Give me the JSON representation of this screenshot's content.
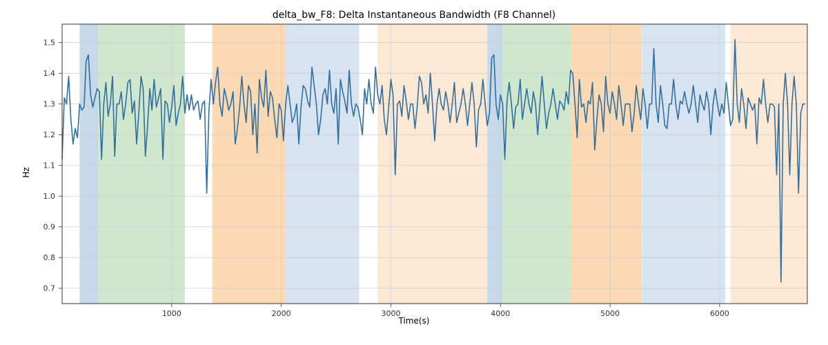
{
  "chart_data": {
    "type": "line",
    "title": "delta_bw_F8: Delta Instantaneous Bandwidth (F8 Channel)",
    "xlabel": "Time(s)",
    "ylabel": "Hz",
    "xlim": [
      0,
      6800
    ],
    "ylim": [
      0.65,
      1.56
    ],
    "xticks": [
      1000,
      2000,
      3000,
      4000,
      5000,
      6000
    ],
    "yticks": [
      0.7,
      0.8,
      0.9,
      1.0,
      1.1,
      1.2,
      1.3,
      1.4,
      1.5
    ],
    "bands": [
      {
        "x0": 160,
        "x1": 330,
        "color": "#c5d9e8"
      },
      {
        "x0": 330,
        "x1": 1120,
        "color": "#cfe7cc"
      },
      {
        "x0": 1370,
        "x1": 2040,
        "color": "#fad9b3"
      },
      {
        "x0": 2040,
        "x1": 2710,
        "color": "#d7e3f0"
      },
      {
        "x0": 2880,
        "x1": 3880,
        "color": "#fce8d3"
      },
      {
        "x0": 3880,
        "x1": 4020,
        "color": "#c5d9e8"
      },
      {
        "x0": 4020,
        "x1": 4640,
        "color": "#cfe7cc"
      },
      {
        "x0": 4640,
        "x1": 5290,
        "color": "#fad9b3"
      },
      {
        "x0": 5290,
        "x1": 6050,
        "color": "#d7e3f0"
      },
      {
        "x0": 6100,
        "x1": 6800,
        "color": "#fce8d3"
      }
    ],
    "series": [
      {
        "name": "delta_bw_F8",
        "color": "#2f6f9f",
        "x_step": 20,
        "values": [
          1.12,
          1.32,
          1.3,
          1.39,
          1.25,
          1.17,
          1.22,
          1.19,
          1.3,
          1.28,
          1.29,
          1.44,
          1.46,
          1.33,
          1.29,
          1.32,
          1.35,
          1.34,
          1.12,
          1.3,
          1.37,
          1.26,
          1.3,
          1.39,
          1.13,
          1.3,
          1.3,
          1.34,
          1.25,
          1.3,
          1.37,
          1.38,
          1.27,
          1.31,
          1.17,
          1.27,
          1.39,
          1.35,
          1.13,
          1.23,
          1.35,
          1.28,
          1.38,
          1.29,
          1.32,
          1.35,
          1.12,
          1.31,
          1.3,
          1.24,
          1.29,
          1.36,
          1.23,
          1.27,
          1.3,
          1.39,
          1.27,
          1.33,
          1.28,
          1.33,
          1.28,
          1.3,
          1.31,
          1.25,
          1.3,
          1.31,
          1.01,
          1.28,
          1.38,
          1.3,
          1.37,
          1.42,
          1.3,
          1.26,
          1.35,
          1.32,
          1.28,
          1.3,
          1.34,
          1.17,
          1.22,
          1.29,
          1.39,
          1.3,
          1.24,
          1.36,
          1.34,
          1.2,
          1.3,
          1.14,
          1.38,
          1.32,
          1.29,
          1.41,
          1.26,
          1.34,
          1.32,
          1.25,
          1.19,
          1.3,
          1.28,
          1.18,
          1.3,
          1.36,
          1.3,
          1.24,
          1.26,
          1.3,
          1.17,
          1.29,
          1.36,
          1.35,
          1.31,
          1.29,
          1.42,
          1.36,
          1.3,
          1.2,
          1.25,
          1.33,
          1.35,
          1.3,
          1.41,
          1.3,
          1.27,
          1.35,
          1.17,
          1.38,
          1.34,
          1.31,
          1.27,
          1.41,
          1.3,
          1.26,
          1.3,
          1.29,
          1.25,
          1.2,
          1.35,
          1.3,
          1.38,
          1.3,
          1.27,
          1.42,
          1.33,
          1.3,
          1.36,
          1.25,
          1.2,
          1.29,
          1.38,
          1.33,
          1.07,
          1.3,
          1.31,
          1.26,
          1.36,
          1.31,
          1.25,
          1.3,
          1.3,
          1.22,
          1.29,
          1.39,
          1.37,
          1.3,
          1.33,
          1.27,
          1.4,
          1.3,
          1.18,
          1.3,
          1.35,
          1.3,
          1.28,
          1.34,
          1.3,
          1.24,
          1.3,
          1.37,
          1.24,
          1.27,
          1.3,
          1.35,
          1.3,
          1.23,
          1.3,
          1.37,
          1.3,
          1.16,
          1.28,
          1.3,
          1.38,
          1.3,
          1.23,
          1.27,
          1.45,
          1.46,
          1.3,
          1.25,
          1.33,
          1.3,
          1.12,
          1.31,
          1.37,
          1.3,
          1.22,
          1.29,
          1.3,
          1.38,
          1.25,
          1.3,
          1.35,
          1.3,
          1.27,
          1.34,
          1.3,
          1.2,
          1.3,
          1.39,
          1.3,
          1.22,
          1.27,
          1.3,
          1.35,
          1.3,
          1.25,
          1.31,
          1.3,
          1.28,
          1.34,
          1.3,
          1.41,
          1.4,
          1.3,
          1.19,
          1.38,
          1.29,
          1.3,
          1.24,
          1.31,
          1.3,
          1.37,
          1.15,
          1.25,
          1.33,
          1.3,
          1.21,
          1.39,
          1.3,
          1.27,
          1.34,
          1.3,
          1.25,
          1.36,
          1.3,
          1.23,
          1.3,
          1.3,
          1.3,
          1.21,
          1.27,
          1.36,
          1.3,
          1.25,
          1.35,
          1.3,
          1.22,
          1.3,
          1.3,
          1.48,
          1.3,
          1.24,
          1.36,
          1.3,
          1.23,
          1.22,
          1.3,
          1.3,
          1.38,
          1.3,
          1.25,
          1.31,
          1.3,
          1.34,
          1.3,
          1.27,
          1.3,
          1.36,
          1.3,
          1.24,
          1.33,
          1.3,
          1.28,
          1.34,
          1.3,
          1.2,
          1.3,
          1.35,
          1.3,
          1.26,
          1.3,
          1.27,
          1.37,
          1.3,
          1.23,
          1.25,
          1.51,
          1.3,
          1.24,
          1.35,
          1.3,
          1.22,
          1.32,
          1.3,
          1.28,
          1.3,
          1.17,
          1.32,
          1.3,
          1.38,
          1.3,
          1.24,
          1.3,
          1.3,
          1.29,
          1.07,
          1.3,
          0.72,
          1.3,
          1.4,
          1.3,
          1.07,
          1.3,
          1.39,
          1.3,
          1.01,
          1.27,
          1.3,
          1.3
        ]
      }
    ]
  }
}
